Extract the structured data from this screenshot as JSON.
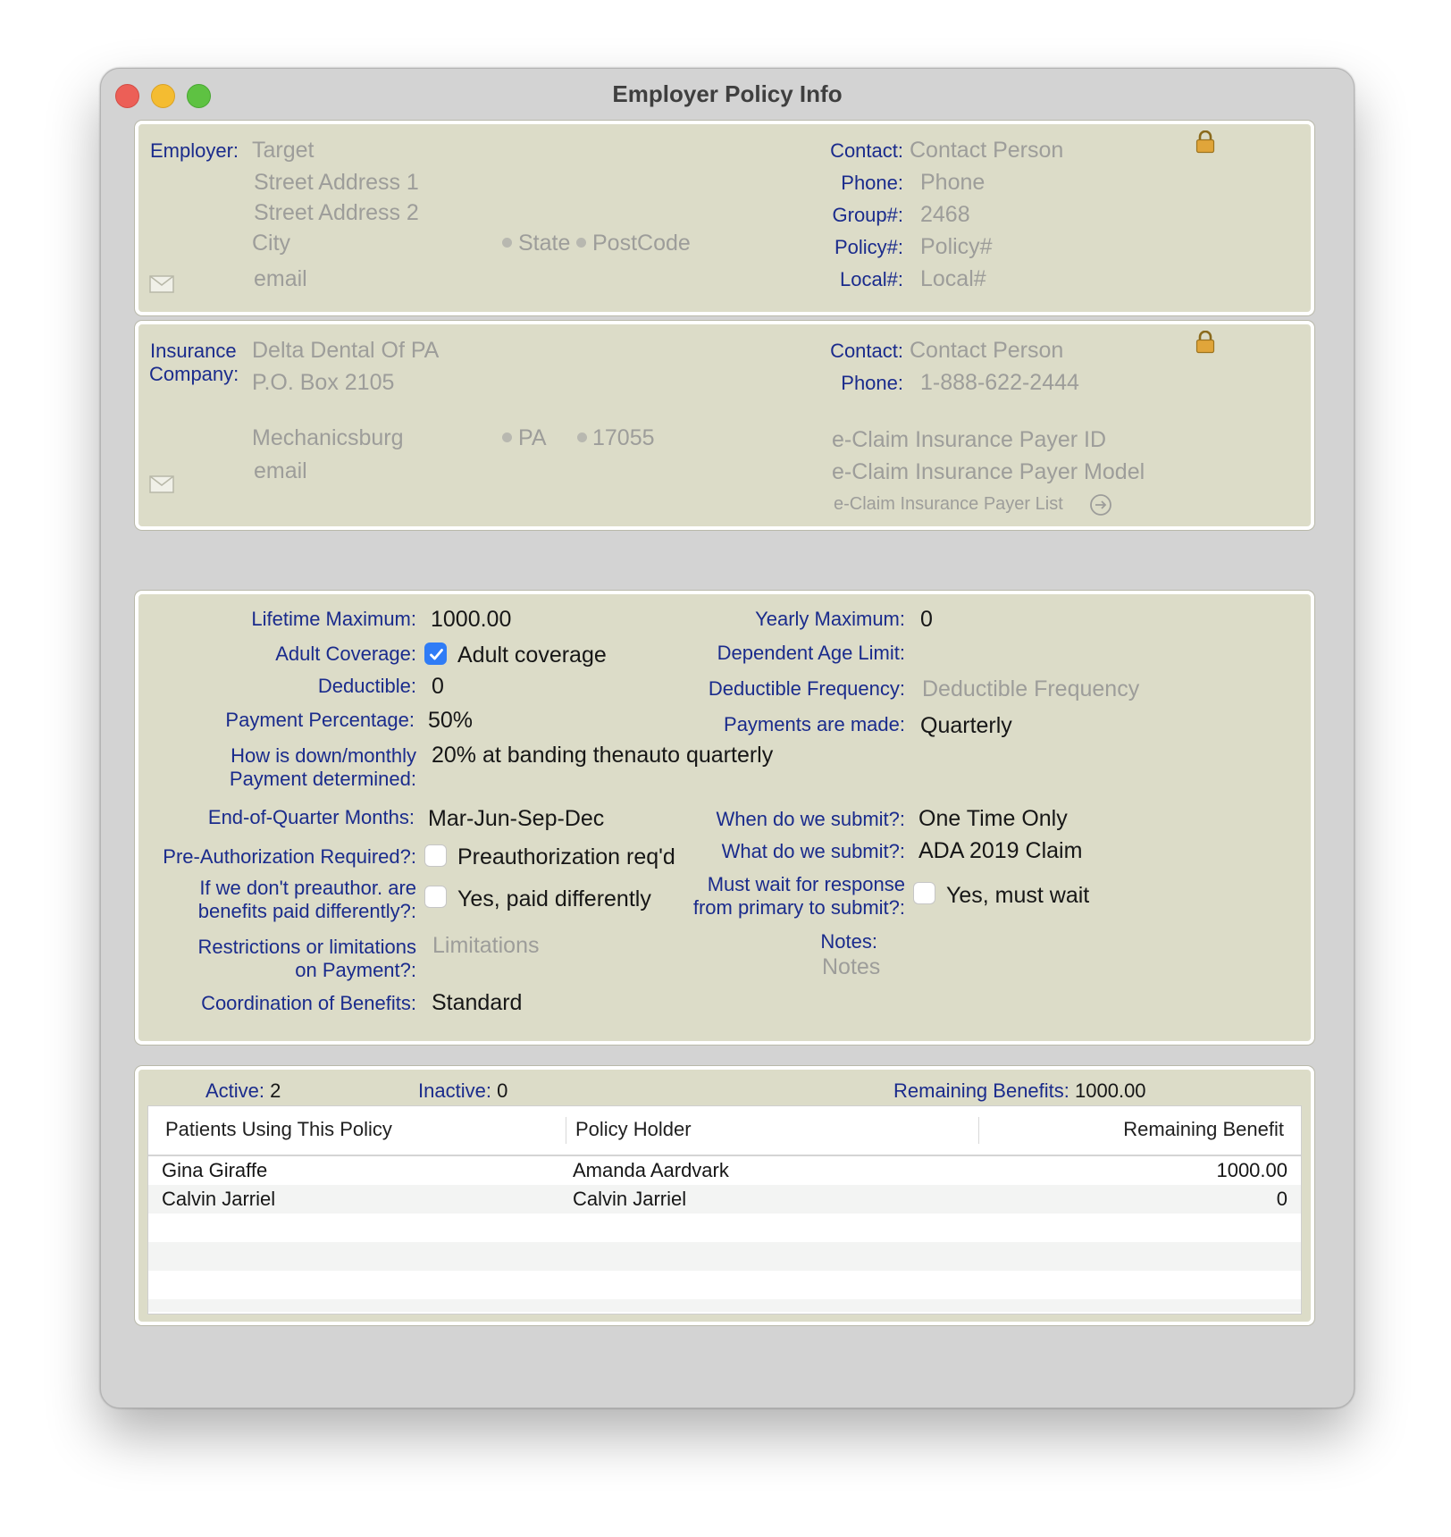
{
  "window": {
    "title": "Employer Policy Info"
  },
  "employer": {
    "label": "Employer:",
    "name": "Target",
    "street1": "Street Address 1",
    "street2": "Street Address 2",
    "city": "City",
    "state": "State",
    "postcode": "PostCode",
    "email": "email",
    "contact_label": "Contact:",
    "contact": "Contact Person",
    "phone_label": "Phone:",
    "phone": "Phone",
    "group_label": "Group#:",
    "group": "2468",
    "policy_label": "Policy#:",
    "policy": "Policy#",
    "local_label": "Local#:",
    "local": "Local#"
  },
  "insurance": {
    "label_line1": "Insurance",
    "label_line2": "Company:",
    "name": "Delta Dental Of PA",
    "street1": "P.O. Box 2105",
    "city": "Mechanicsburg",
    "state": "PA",
    "postcode": "17055",
    "email": "email",
    "contact_label": "Contact:",
    "contact": "Contact Person",
    "phone_label": "Phone:",
    "phone": "1-888-622-2444",
    "payer_id": "e-Claim Insurance Payer ID",
    "payer_model": "e-Claim Insurance Payer Model",
    "payer_list": "e-Claim Insurance Payer List"
  },
  "policy": {
    "lifetime_max_label": "Lifetime Maximum:",
    "lifetime_max": "1000.00",
    "yearly_max_label": "Yearly Maximum:",
    "yearly_max": "0",
    "adult_coverage_label": "Adult Coverage:",
    "adult_coverage_checked": true,
    "adult_coverage_text": "Adult coverage",
    "dependent_age_label": "Dependent Age Limit:",
    "deductible_label": "Deductible:",
    "deductible": "0",
    "deductible_freq_label": "Deductible Frequency:",
    "deductible_freq": "Deductible Frequency",
    "payment_pct_label": "Payment Percentage:",
    "payment_pct": "50%",
    "payments_made_label": "Payments are made:",
    "payments_made": "Quarterly",
    "down_monthly_label_line1": "How is down/monthly",
    "down_monthly_label_line2": "Payment determined:",
    "down_monthly": "20% at banding thenauto quarterly",
    "eoq_label": "End-of-Quarter Months:",
    "eoq": "Mar-Jun-Sep-Dec",
    "when_submit_label": "When do we submit?:",
    "when_submit": "One Time Only",
    "preauth_label": "Pre-Authorization Required?:",
    "preauth_checked": false,
    "preauth_text": "Preauthorization req'd",
    "what_submit_label": "What do we submit?:",
    "what_submit": "ADA 2019 Claim",
    "paid_diff_label_line1": "If we don't preauthor. are",
    "paid_diff_label_line2": "benefits paid differently?:",
    "paid_diff_checked": false,
    "paid_diff_text": "Yes, paid differently",
    "must_wait_label_line1": "Must wait for response",
    "must_wait_label_line2": "from primary to submit?:",
    "must_wait_checked": false,
    "must_wait_text": "Yes, must wait",
    "restrictions_label_line1": "Restrictions or limitations",
    "restrictions_label_line2": "on Payment?:",
    "restrictions": "Limitations",
    "notes_label": "Notes:",
    "notes": "Notes",
    "cob_label": "Coordination of Benefits:",
    "cob": "Standard"
  },
  "patients": {
    "active_label": "Active:",
    "active": "2",
    "inactive_label": "Inactive:",
    "inactive": "0",
    "remaining_label": "Remaining Benefits:",
    "remaining": "1000.00",
    "columns": [
      "Patients Using This Policy",
      "Policy Holder",
      "Remaining Benefit"
    ],
    "rows": [
      {
        "patient": "Gina Giraffe",
        "holder": "Amanda Aardvark",
        "remaining": "1000.00"
      },
      {
        "patient": "Calvin Jarriel",
        "holder": "Calvin Jarriel",
        "remaining": "0"
      }
    ]
  },
  "colors": {
    "panel_bg": "#dcdcc8",
    "label_blue": "#1a2b8c",
    "placeholder_gray": "#9d9d9a",
    "checkbox_blue": "#2f7cf6"
  }
}
